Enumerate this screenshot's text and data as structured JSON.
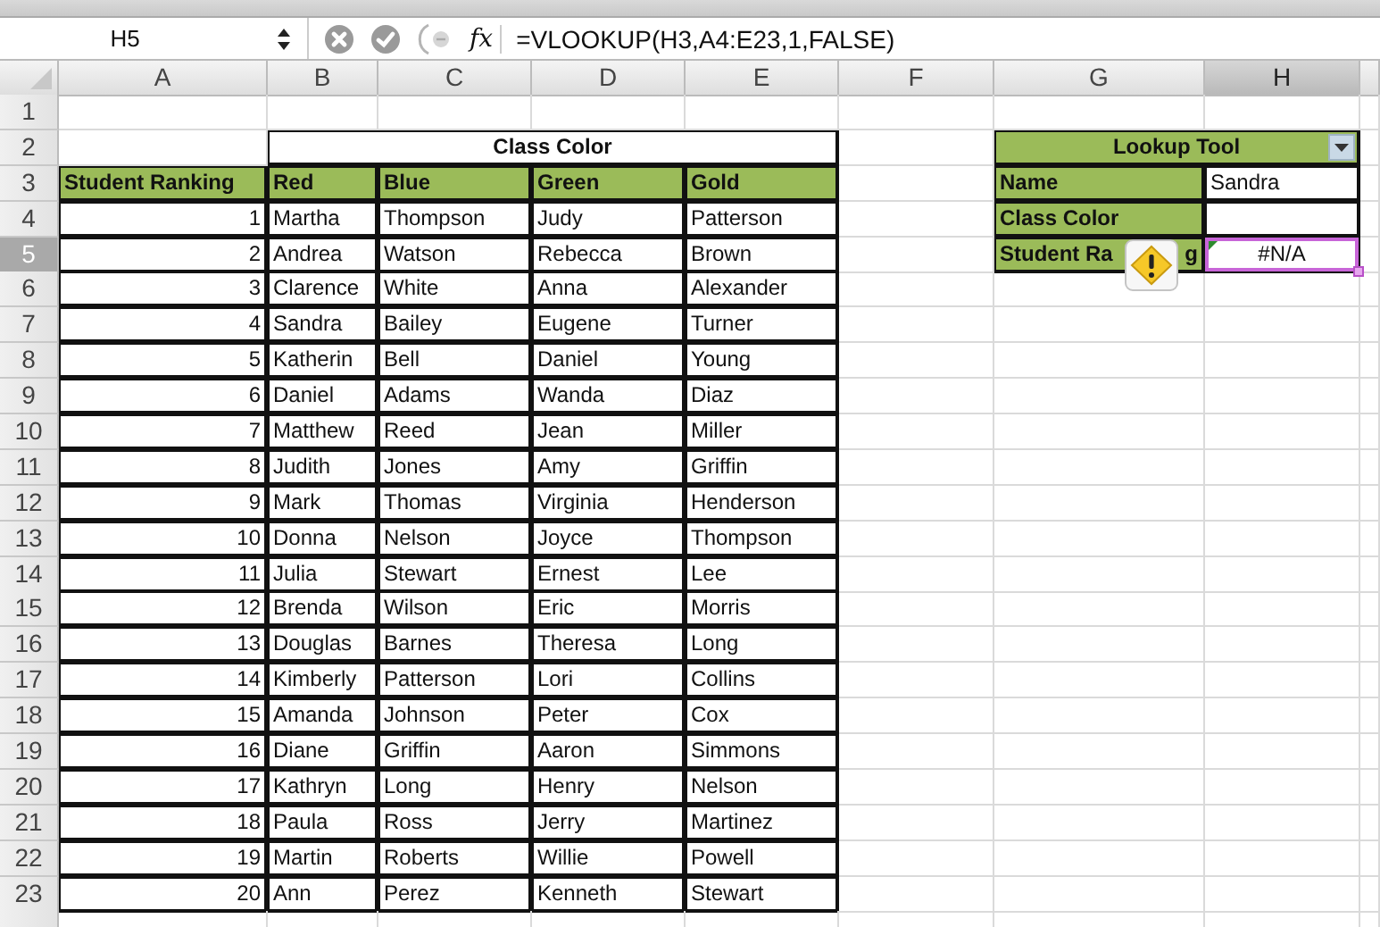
{
  "formula_bar": {
    "name_box": "H5",
    "fx_label": "fx",
    "formula": "=VLOOKUP(H3,A4:E23,1,FALSE)"
  },
  "columns": [
    {
      "label": "A",
      "selected": false
    },
    {
      "label": "B",
      "selected": false
    },
    {
      "label": "C",
      "selected": false
    },
    {
      "label": "D",
      "selected": false
    },
    {
      "label": "E",
      "selected": false
    },
    {
      "label": "F",
      "selected": false
    },
    {
      "label": "G",
      "selected": false
    },
    {
      "label": "H",
      "selected": true
    }
  ],
  "rows": [
    {
      "label": "1",
      "selected": false
    },
    {
      "label": "2",
      "selected": false
    },
    {
      "label": "3",
      "selected": false
    },
    {
      "label": "4",
      "selected": false
    },
    {
      "label": "5",
      "selected": true
    },
    {
      "label": "6",
      "selected": false
    },
    {
      "label": "7",
      "selected": false
    },
    {
      "label": "8",
      "selected": false
    },
    {
      "label": "9",
      "selected": false
    },
    {
      "label": "10",
      "selected": false
    },
    {
      "label": "11",
      "selected": false
    },
    {
      "label": "12",
      "selected": false
    },
    {
      "label": "13",
      "selected": false
    },
    {
      "label": "14",
      "selected": false
    },
    {
      "label": "15",
      "selected": false
    },
    {
      "label": "16",
      "selected": false
    },
    {
      "label": "17",
      "selected": false
    },
    {
      "label": "18",
      "selected": false
    },
    {
      "label": "19",
      "selected": false
    },
    {
      "label": "20",
      "selected": false
    },
    {
      "label": "21",
      "selected": false
    },
    {
      "label": "22",
      "selected": false
    },
    {
      "label": "23",
      "selected": false
    }
  ],
  "class_table": {
    "title": "Class Color",
    "headers": [
      "Student Ranking",
      "Red",
      "Blue",
      "Green",
      "Gold"
    ],
    "rows": [
      [
        "1",
        "Martha",
        "Thompson",
        "Judy",
        "Patterson"
      ],
      [
        "2",
        "Andrea",
        "Watson",
        "Rebecca",
        "Brown"
      ],
      [
        "3",
        "Clarence",
        "White",
        "Anna",
        "Alexander"
      ],
      [
        "4",
        "Sandra",
        "Bailey",
        "Eugene",
        "Turner"
      ],
      [
        "5",
        "Katherin",
        "Bell",
        "Daniel",
        "Young"
      ],
      [
        "6",
        "Daniel",
        "Adams",
        "Wanda",
        "Diaz"
      ],
      [
        "7",
        "Matthew",
        "Reed",
        "Jean",
        "Miller"
      ],
      [
        "8",
        "Judith",
        "Jones",
        "Amy",
        "Griffin"
      ],
      [
        "9",
        "Mark",
        "Thomas",
        "Virginia",
        "Henderson"
      ],
      [
        "10",
        "Donna",
        "Nelson",
        "Joyce",
        "Thompson"
      ],
      [
        "11",
        "Julia",
        "Stewart",
        "Ernest",
        "Lee"
      ],
      [
        "12",
        "Brenda",
        "Wilson",
        "Eric",
        "Morris"
      ],
      [
        "13",
        "Douglas",
        "Barnes",
        "Theresa",
        "Long"
      ],
      [
        "14",
        "Kimberly",
        "Patterson",
        "Lori",
        "Collins"
      ],
      [
        "15",
        "Amanda",
        "Johnson",
        "Peter",
        "Cox"
      ],
      [
        "16",
        "Diane",
        "Griffin",
        "Aaron",
        "Simmons"
      ],
      [
        "17",
        "Kathryn",
        "Long",
        "Henry",
        "Nelson"
      ],
      [
        "18",
        "Paula",
        "Ross",
        "Jerry",
        "Martinez"
      ],
      [
        "19",
        "Martin",
        "Roberts",
        "Willie",
        "Powell"
      ],
      [
        "20",
        "Ann",
        "Perez",
        "Kenneth",
        "Stewart"
      ]
    ]
  },
  "lookup_tool": {
    "title": "Lookup Tool",
    "fields": [
      {
        "label": "Name",
        "value": "Sandra",
        "selected": false
      },
      {
        "label": "Class Color",
        "selected": false
      },
      {
        "label": "Student Ra",
        "label_tail": "g",
        "value": "#N/A",
        "selected": true,
        "warning": true
      }
    ]
  }
}
